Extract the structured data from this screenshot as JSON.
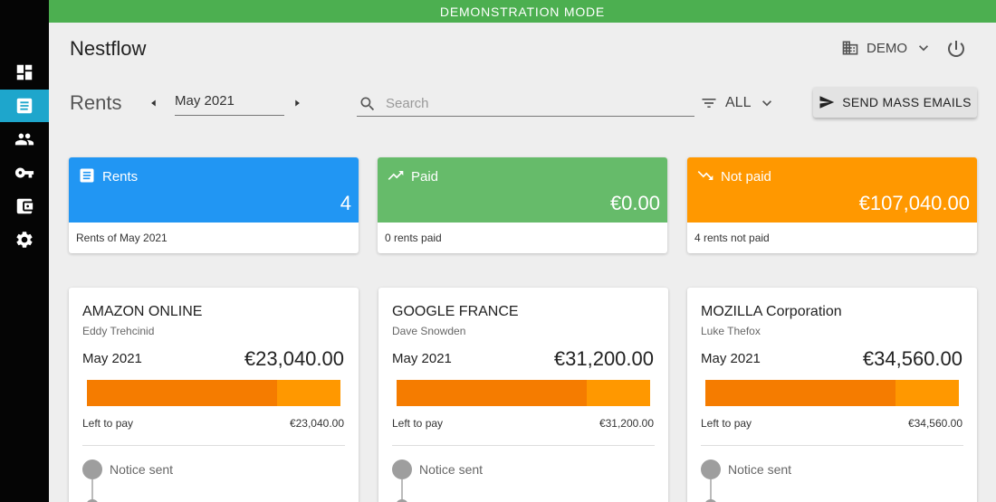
{
  "banner": "DEMONSTRATION MODE",
  "app_title": "Nestflow",
  "org": {
    "name": "DEMO",
    "icon": "building-icon"
  },
  "page_title": "Rents",
  "month": "May 2021",
  "search": {
    "placeholder": "Search",
    "value": ""
  },
  "filter": {
    "label": "ALL"
  },
  "mass_email_label": "SEND MASS EMAILS",
  "sidebar": {
    "items": [
      {
        "name": "dashboard",
        "icon": "dashboard-icon",
        "active": false
      },
      {
        "name": "rents",
        "icon": "receipt-icon",
        "active": true
      },
      {
        "name": "tenants",
        "icon": "people-icon",
        "active": false
      },
      {
        "name": "properties",
        "icon": "key-icon",
        "active": false
      },
      {
        "name": "accounting",
        "icon": "wallet-icon",
        "active": false
      },
      {
        "name": "settings",
        "icon": "gear-icon",
        "active": false
      }
    ]
  },
  "stats": [
    {
      "label": "Rents",
      "value": "4",
      "footer": "Rents of May 2021",
      "color": "#2196f3",
      "icon": "receipt-icon"
    },
    {
      "label": "Paid",
      "value": "€0.00",
      "footer": "0 rents paid",
      "color": "#66bb6a",
      "icon": "trending-up-icon"
    },
    {
      "label": "Not paid",
      "value": "€107,040.00",
      "footer": "4 rents not paid",
      "color": "#ff9800",
      "icon": "trending-down-icon"
    }
  ],
  "tenants": [
    {
      "name": "AMAZON ONLINE",
      "contact": "Eddy Trehcinid",
      "month": "May 2021",
      "amount": "€23,040.00",
      "left_label": "Left to pay",
      "left_value": "€23,040.00",
      "bar_fraction": 0.75,
      "status": "Notice sent"
    },
    {
      "name": "GOOGLE FRANCE",
      "contact": "Dave Snowden",
      "month": "May 2021",
      "amount": "€31,200.00",
      "left_label": "Left to pay",
      "left_value": "€31,200.00",
      "bar_fraction": 0.75,
      "status": "Notice sent"
    },
    {
      "name": "MOZILLA Corporation",
      "contact": "Luke Thefox",
      "month": "May 2021",
      "amount": "€34,560.00",
      "left_label": "Left to pay",
      "left_value": "€34,560.00",
      "bar_fraction": 0.75,
      "status": "Notice sent"
    }
  ],
  "colors": {
    "accent": "#1ea6cc",
    "banner": "#4caf50",
    "bar_dark": "#f57c00",
    "bar_light": "#ff9800"
  }
}
